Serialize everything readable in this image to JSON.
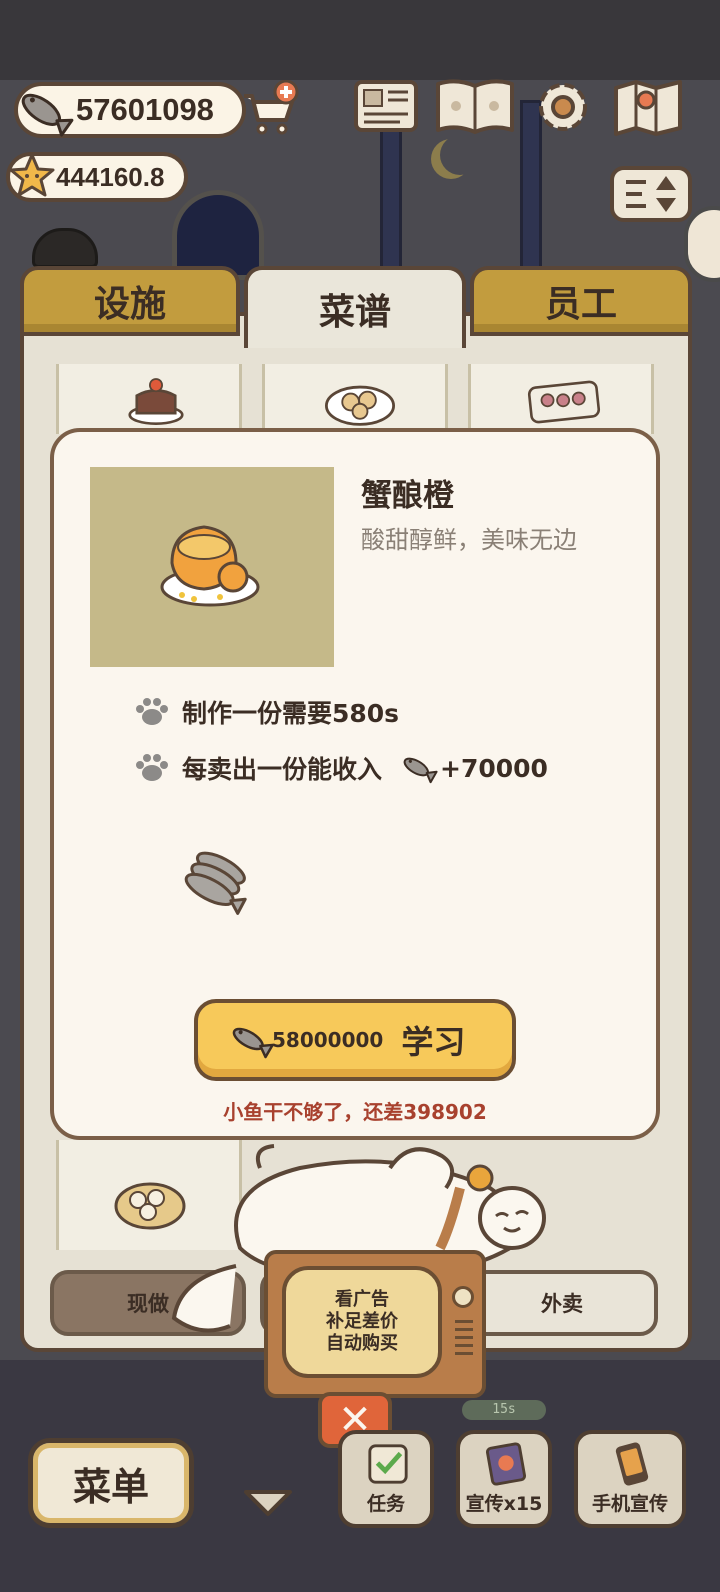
{
  "hud": {
    "fish_currency": "57601098",
    "star_currency": "444160.8"
  },
  "tabs": [
    {
      "label": "设施",
      "active": false
    },
    {
      "label": "菜谱",
      "active": true
    },
    {
      "label": "员工",
      "active": false
    }
  ],
  "recipe_modal": {
    "name": "蟹酿橙",
    "description": "酸甜醇鲜，美味无边",
    "make_time_text": "制作一份需要580s",
    "income_text": "每卖出一份能收入",
    "income_value": "+70000",
    "learn_button": {
      "price": "58000000",
      "label": "学习"
    },
    "warning": "小鱼干不够了，还差398902"
  },
  "ad_tv": {
    "lines": [
      "看广告",
      "补足差价",
      "自动购买"
    ]
  },
  "segments": [
    {
      "label": "现做",
      "selected": true
    },
    {
      "label": "",
      "selected": false
    },
    {
      "label": "外卖",
      "selected": false
    }
  ],
  "bottom_bar": {
    "menu_label": "菜单",
    "task_label": "任务",
    "promo_label": "宣传x15",
    "phone_promo_label": "手机宣传",
    "timer": "15s"
  },
  "colors": {
    "tab_inactive": "#c29c3e",
    "learn_button": "#f7c95a",
    "warning_text": "#a8412e",
    "panel_border": "#5a4637"
  }
}
